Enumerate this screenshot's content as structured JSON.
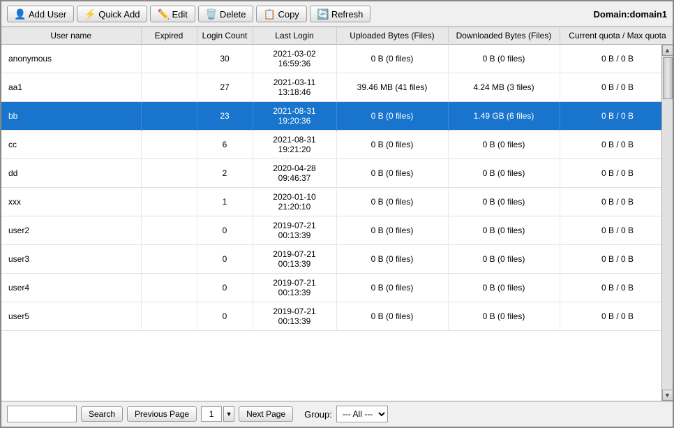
{
  "toolbar": {
    "add_user_label": "Add User",
    "quick_add_label": "Quick Add",
    "edit_label": "Edit",
    "delete_label": "Delete",
    "copy_label": "Copy",
    "refresh_label": "Refresh"
  },
  "domain": {
    "label": "Domain:",
    "value": "domain1"
  },
  "table": {
    "headers": [
      "User name",
      "Expired",
      "Login Count",
      "Last Login",
      "Uploaded Bytes (Files)",
      "Downloaded Bytes (Files)",
      "Current quota / Max quota"
    ],
    "rows": [
      {
        "username": "anonymous",
        "expired": "",
        "login_count": "30",
        "last_login": "2021-03-02\n16:59:36",
        "uploaded": "0 B (0 files)",
        "downloaded": "0 B (0 files)",
        "quota": "0 B / 0 B",
        "selected": false
      },
      {
        "username": "aa1",
        "expired": "",
        "login_count": "27",
        "last_login": "2021-03-11\n13:18:46",
        "uploaded": "39.46 MB (41 files)",
        "downloaded": "4.24 MB (3 files)",
        "quota": "0 B / 0 B",
        "selected": false
      },
      {
        "username": "bb",
        "expired": "",
        "login_count": "23",
        "last_login": "2021-08-31\n19:20:36",
        "uploaded": "0 B (0 files)",
        "downloaded": "1.49 GB (6 files)",
        "quota": "0 B / 0 B",
        "selected": true
      },
      {
        "username": "cc",
        "expired": "",
        "login_count": "6",
        "last_login": "2021-08-31\n19:21:20",
        "uploaded": "0 B (0 files)",
        "downloaded": "0 B (0 files)",
        "quota": "0 B / 0 B",
        "selected": false
      },
      {
        "username": "dd",
        "expired": "",
        "login_count": "2",
        "last_login": "2020-04-28\n09:46:37",
        "uploaded": "0 B (0 files)",
        "downloaded": "0 B (0 files)",
        "quota": "0 B / 0 B",
        "selected": false
      },
      {
        "username": "xxx",
        "expired": "",
        "login_count": "1",
        "last_login": "2020-01-10\n21:20:10",
        "uploaded": "0 B (0 files)",
        "downloaded": "0 B (0 files)",
        "quota": "0 B / 0 B",
        "selected": false
      },
      {
        "username": "user2",
        "expired": "",
        "login_count": "0",
        "last_login": "2019-07-21\n00:13:39",
        "uploaded": "0 B (0 files)",
        "downloaded": "0 B (0 files)",
        "quota": "0 B / 0 B",
        "selected": false
      },
      {
        "username": "user3",
        "expired": "",
        "login_count": "0",
        "last_login": "2019-07-21\n00:13:39",
        "uploaded": "0 B (0 files)",
        "downloaded": "0 B (0 files)",
        "quota": "0 B / 0 B",
        "selected": false
      },
      {
        "username": "user4",
        "expired": "",
        "login_count": "0",
        "last_login": "2019-07-21\n00:13:39",
        "uploaded": "0 B (0 files)",
        "downloaded": "0 B (0 files)",
        "quota": "0 B / 0 B",
        "selected": false
      },
      {
        "username": "user5",
        "expired": "",
        "login_count": "0",
        "last_login": "2019-07-21\n00:13:39",
        "uploaded": "0 B (0 files)",
        "downloaded": "0 B (0 files)",
        "quota": "0 B / 0 B",
        "selected": false
      }
    ]
  },
  "footer": {
    "search_placeholder": "",
    "search_label": "Search",
    "prev_page_label": "Previous Page",
    "next_page_label": "Next Page",
    "page_number": "1",
    "group_label": "Group:",
    "group_options": [
      "--- All ---"
    ],
    "group_selected": "--- All ---"
  }
}
